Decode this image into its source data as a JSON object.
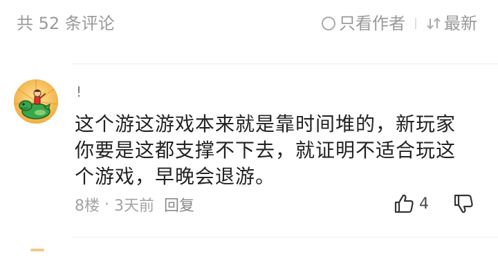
{
  "header": {
    "comment_count": "共 52 条评论",
    "sort_hot": "只看作者",
    "sort_new": "最新"
  },
  "comment": {
    "username": "!",
    "text": "这个游这游戏本来就是靠时间堆的，新玩家你要是这都支撑不下去，就证明不适合玩这个游戏，早晚会退游。",
    "floor": "8楼",
    "dot": "·",
    "time": "3天前",
    "reply_label": "回复",
    "like_count": "4",
    "avatar_icon": "cartoon-dinosaur-rider-avatar",
    "like_icon": "thumbs-up-icon",
    "dislike_icon": "thumbs-down-icon"
  },
  "colors": {
    "text_primary": "#222222",
    "text_muted": "#a3a3a3",
    "divider": "#eeeeee",
    "avatar_bg": "#f6c667"
  }
}
